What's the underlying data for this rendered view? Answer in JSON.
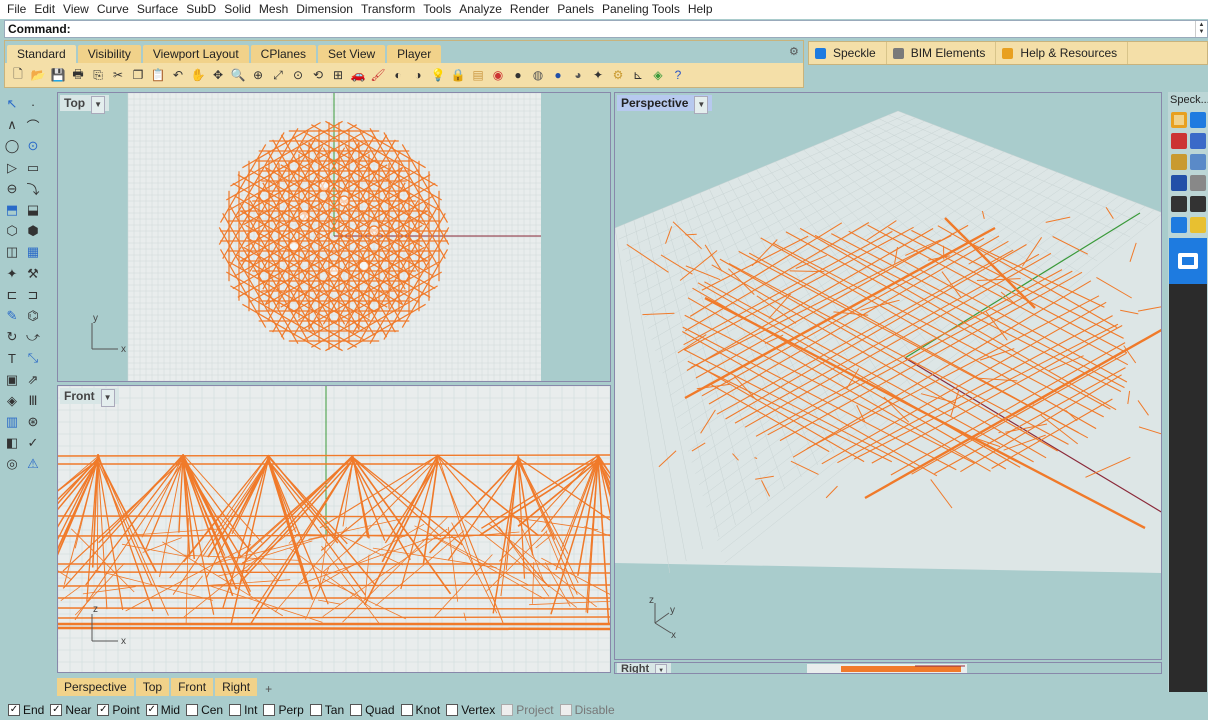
{
  "menu": [
    "File",
    "Edit",
    "View",
    "Curve",
    "Surface",
    "SubD",
    "Solid",
    "Mesh",
    "Dimension",
    "Transform",
    "Tools",
    "Analyze",
    "Render",
    "Panels",
    "Paneling Tools",
    "Help"
  ],
  "command": {
    "label": "Command:",
    "value": ""
  },
  "toolbar_tabs": [
    "Standard",
    "Visibility",
    "Viewport Layout",
    "CPlanes",
    "Set View",
    "Player"
  ],
  "toolbar_icons": [
    "new-file-icon",
    "open-folder-icon",
    "save-icon",
    "print-icon",
    "import-icon",
    "cut-icon",
    "copy-icon",
    "paste-icon",
    "undo-icon",
    "pan-hand-icon",
    "move-icon",
    "zoom-icon",
    "zoom-window-icon",
    "zoom-extents-icon",
    "zoom-selected-icon",
    "rotate-view-icon",
    "four-views-icon",
    "car-icon",
    "paint-icon",
    "hide-icon",
    "show-icon",
    "light-icon",
    "lock-icon",
    "layer-icon",
    "color-wheel-icon",
    "render-sphere-icon",
    "material-sphere-icon",
    "blue-sphere-icon",
    "camera-sphere-icon",
    "wand-icon",
    "gear-icon",
    "dimension-icon",
    "grasshopper-icon",
    "help-icon"
  ],
  "right_tabs": [
    {
      "label": "Speckle",
      "color": "#1e7be0"
    },
    {
      "label": "BIM Elements",
      "color": "#7a7a7a"
    },
    {
      "label": "Help & Resources",
      "color": "#e8a020"
    }
  ],
  "viewports": {
    "top": {
      "label": "Top"
    },
    "front": {
      "label": "Front"
    },
    "perspective": {
      "label": "Perspective"
    },
    "right": {
      "label": "Right"
    }
  },
  "axis_labels": {
    "x": "x",
    "y": "y",
    "z": "z"
  },
  "bottom_tabs": [
    "Perspective",
    "Top",
    "Front",
    "Right"
  ],
  "bottom_tab_plus": "+",
  "osnaps": [
    {
      "label": "End",
      "checked": true,
      "disabled": false
    },
    {
      "label": "Near",
      "checked": true,
      "disabled": false
    },
    {
      "label": "Point",
      "checked": true,
      "disabled": false
    },
    {
      "label": "Mid",
      "checked": true,
      "disabled": false
    },
    {
      "label": "Cen",
      "checked": false,
      "disabled": false
    },
    {
      "label": "Int",
      "checked": false,
      "disabled": false
    },
    {
      "label": "Perp",
      "checked": false,
      "disabled": false
    },
    {
      "label": "Tan",
      "checked": false,
      "disabled": false
    },
    {
      "label": "Quad",
      "checked": false,
      "disabled": false
    },
    {
      "label": "Knot",
      "checked": false,
      "disabled": false
    },
    {
      "label": "Vertex",
      "checked": false,
      "disabled": false
    },
    {
      "label": "Project",
      "checked": false,
      "disabled": true
    },
    {
      "label": "Disable",
      "checked": false,
      "disabled": true
    }
  ],
  "right_panel": {
    "title": "Speck..."
  },
  "colors": {
    "geometry": "#f07a2a",
    "x_axis": "#8b2a3a",
    "y_axis": "#3a9a3a",
    "grid_bg": "#e9eded",
    "grid_line": "#d0d8d8"
  }
}
